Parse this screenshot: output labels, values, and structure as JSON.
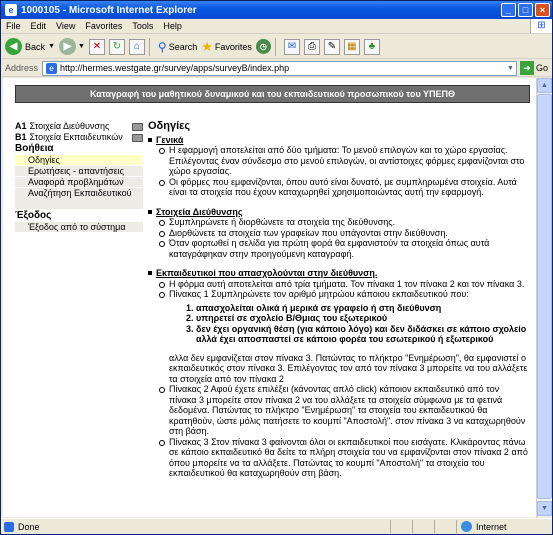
{
  "window": {
    "title": "1000105 - Microsoft Internet Explorer",
    "minimize": "_",
    "maximize": "□",
    "close": "×",
    "icon_glyph": "e"
  },
  "menu": [
    "File",
    "Edit",
    "View",
    "Favorites",
    "Tools",
    "Help"
  ],
  "toolbar": {
    "back_label": "Back",
    "search_label": "Search",
    "favorites_label": "Favorites"
  },
  "address": {
    "label": "Address",
    "url": "http://hermes.westgate.gr/survey/apps/surveyB/index.php",
    "go_label": "Go"
  },
  "page": {
    "header": "Καταγραφή του μαθητικού δυναμικού και του εκπαιδευτικού προσωπικού του ΥΠΕΠΘ",
    "sidebar": {
      "a1_code": "A1",
      "a1_label": "Στοιχεία Διεύθυνσης",
      "b1_code": "B1",
      "b1_label": "Στοιχεία Εκπαιδευτικών",
      "help_title": "Βοήθεια",
      "help_items": [
        "Οδηγίες",
        "Ερωτήσεις - απαντήσεις",
        "Αναφορά προβλημάτων",
        "Αναζήτηση Εκπαιδευτικού"
      ],
      "exit_title": "Έξοδος",
      "exit_item": "Έξοδος από το σύστημα"
    },
    "content": {
      "title": "Οδηγίες",
      "s1_title": "Γενικά",
      "s1_b1": "Η εφαρμογή αποτελείται από δύο τμήματα: Το μενού επιλογών και το χώρο εργασίας. Επιλέγοντας έναν σύνδεσμο στο μενού επιλογών, οι αντίστοιχες φόρμες εμφανίζονται στο χώρο εργασίας.",
      "s1_b2": "Οι φόρμες που εμφανίζονται, όπου αυτό είναι δυνατό, με συμπληρωμένα στοιχεία. Αυτά είναι τα στοιχεία που έχουν καταχωρηθεί χρησιμοποιώντας αυτή την εφαρμογή.",
      "s2_title": "Στοιχεία Διεύθυνσης",
      "s2_b1": "Συμπληρώνετε ή διορθώνετε τα στοιχεία της διεύθυνσης.",
      "s2_b2": "Διορθώνετε τα στοιχεία των γραφείων που υπάγονται στην διεύθυνση.",
      "s2_b3": "Όταν φορτωθεί η σελίδα για πρώτη φορά θα εμφανιστούν τα στοιχεία όπως αυτά καταγράφηκαν στην προηγούμενη καταγραφή.",
      "s3_title": "Εκπαιδευτικοί που απασχολούνται στην διεύθυνση.",
      "s3_b1": "Η φόρμα αυτή αποτελείται από τρία τμήματα. Τον πίνακα 1 τον πίνακα 2 και τον πίνακα 3.",
      "s3_b2": "Πίνακας 1 Συμπληρώνετε τον αριθμό μητρώου κάποιου εκπαιδευτικού που:",
      "s3_list": [
        "απασχολείται ολικά ή μερικά σε γραφείο ή στη διεύθυνση",
        "υπηρετεί σε σχολείο Β/Θμιας του εξωτερικού",
        "δεν έχει οργανική θέση (για κάποιο λόγο) και δεν διδάσκει σε κάποιο σχολείο αλλά έχει αποσπαστεί σε κάποιο φορέα του εσωτερικού ή εξωτερικού"
      ],
      "s3_para": "αλλα δεν εμφανίζεται στον πίνακα 3. Πατώντας το πλήκτρο \"Ενημέρωση\", θα εμφανιστεί ο εκπαιδευτικός στον πίνακα 3. Επιλέγοντας τον από τον πίνακα 3 μπορείτε να του αλλάξετε τα στοιχεία από τον πίνακα 2",
      "s3_b3": "Πίνακας 2 Αφού έχετε επιλέξει (κάνοντας απλό click) κάποιον εκπαιδευτικό από τον πίνακα 3 μπορείτε στον πίνακα 2 να του αλλάξετε τα στοιχεία σύμφωνα με τα φετινά δεδομένα. Πατώντας το πλήκτρο \"Ενημέρωση\" τα στοιχεία του εκπαιδευτικού θα κρατηθούν, ώστε μόλις πατήσετε το κουμπί \"Αποστολή\". στον πίνακα 3 να καταχωρηθούν στη βάση.",
      "s3_b4": "Πίνακας 3 Στον πίνακα 3 φαίνονται όλοι οι εκπαιδευτικοί που εισάγατε. Κλικάροντας πάνω σε κάποιο εκπαιδευτικό θα δείτε τα πλήρη στοιχεία του να εμφανίζονται στον πίνακα 2 από όπου μπορείτε να τα αλλάξετε. Πατώντας το κουμπί \"Αποστολή\" τα στοιχεία του εκπαιδευτικού θα καταχωρηθούν στη βάση."
    }
  },
  "status": {
    "left": "Done",
    "zone": "Internet"
  }
}
